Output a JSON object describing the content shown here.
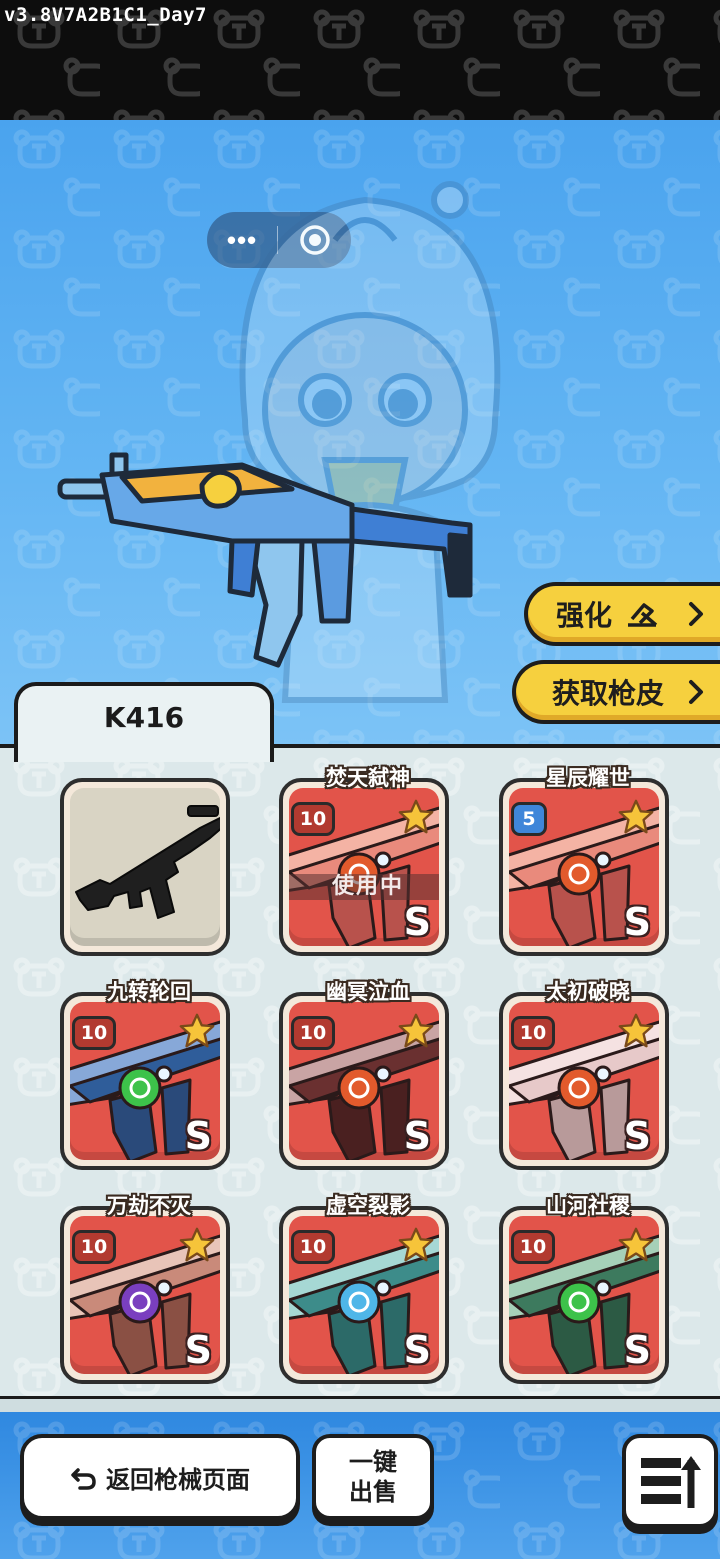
{
  "app": {
    "version": "v3.8V7A2B1C1_Day7"
  },
  "capsule": {
    "more": "•••"
  },
  "actions": {
    "enhance_label": "强化",
    "get_skin_label": "获取枪皮"
  },
  "weapon": {
    "name": "K416"
  },
  "skins": [
    {
      "name": "",
      "original": true
    },
    {
      "name": "焚天弑神",
      "level": "10",
      "grade": "S",
      "status": "使用中"
    },
    {
      "name": "星辰耀世",
      "level": "5",
      "grade": "S"
    },
    {
      "name": "九转轮回",
      "level": "10",
      "grade": "S"
    },
    {
      "name": "幽冥泣血",
      "level": "10",
      "grade": "S"
    },
    {
      "name": "太初破晓",
      "level": "10",
      "grade": "S"
    },
    {
      "name": "万劫不灭",
      "level": "10",
      "grade": "S"
    },
    {
      "name": "虚空裂影",
      "level": "10",
      "grade": "S"
    },
    {
      "name": "山河社稷",
      "level": "10",
      "grade": "S"
    }
  ],
  "footer": {
    "back_label": "返回枪械页面",
    "sell_line1": "一键",
    "sell_line2": "出售"
  },
  "colors": {
    "hero_blue": "#4aa3ee",
    "button_yellow": "#f6d03e",
    "card_red": "#e2544a",
    "panel_bg": "#dce8ea"
  }
}
